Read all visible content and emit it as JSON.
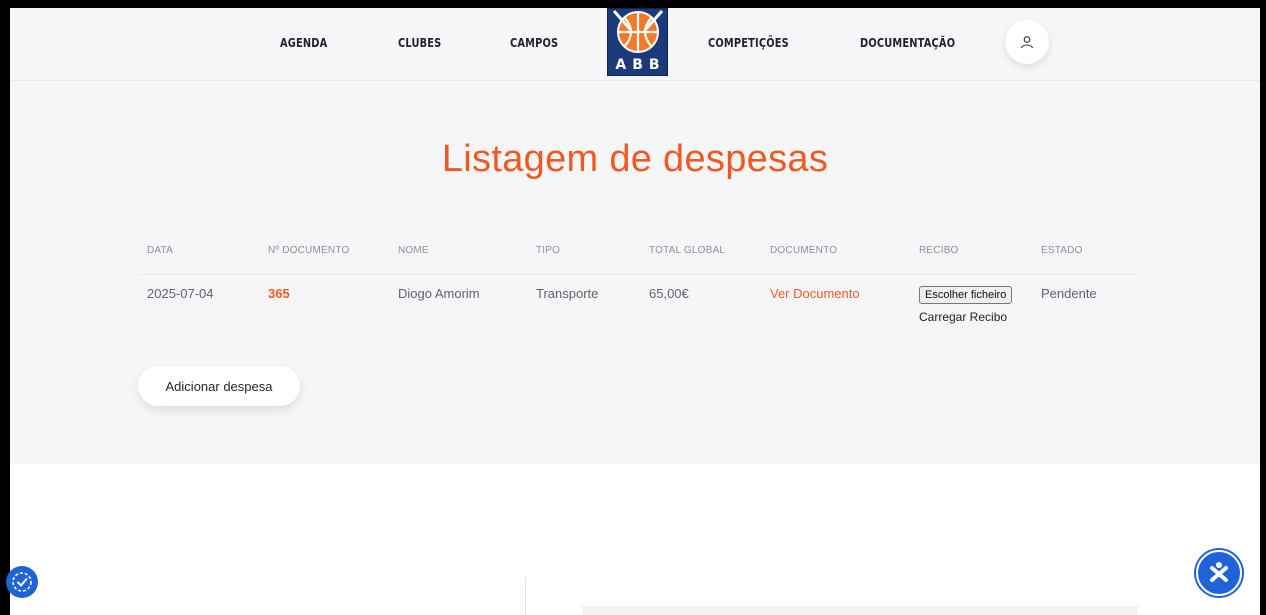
{
  "nav": {
    "links": [
      "AGENDA",
      "CLUBES",
      "CAMPOS",
      "COMPETIÇÕES",
      "DOCUMENTAÇÃO"
    ],
    "logo_text": "ABB"
  },
  "page": {
    "title": "Listagem de despesas"
  },
  "table": {
    "headers": [
      "DATA",
      "Nº DOCUMENTO",
      "NOME",
      "TIPO",
      "TOTAL GLOBAL",
      "DOCUMENTO",
      "RECIBO",
      "ESTADO"
    ],
    "rows": [
      {
        "data": "2025-07-04",
        "documento_num": "365",
        "nome": "Diogo Amorim",
        "tipo": "Transporte",
        "total": "65,00€",
        "documento_link": "Ver Documento",
        "recibo_file_button": "Escolher ficheiro",
        "recibo_upload": "Carregar Recibo",
        "estado": "Pendente"
      }
    ]
  },
  "actions": {
    "add_expense": "Adicionar despesa"
  },
  "colors": {
    "accent": "#f05a22",
    "fab": "#1f63d9",
    "hero_bg": "#f6f6f8"
  },
  "icons": {
    "user": "user-icon",
    "accessibility_left": "accessibility-icon",
    "accessibility_right": "accessibility-icon"
  }
}
